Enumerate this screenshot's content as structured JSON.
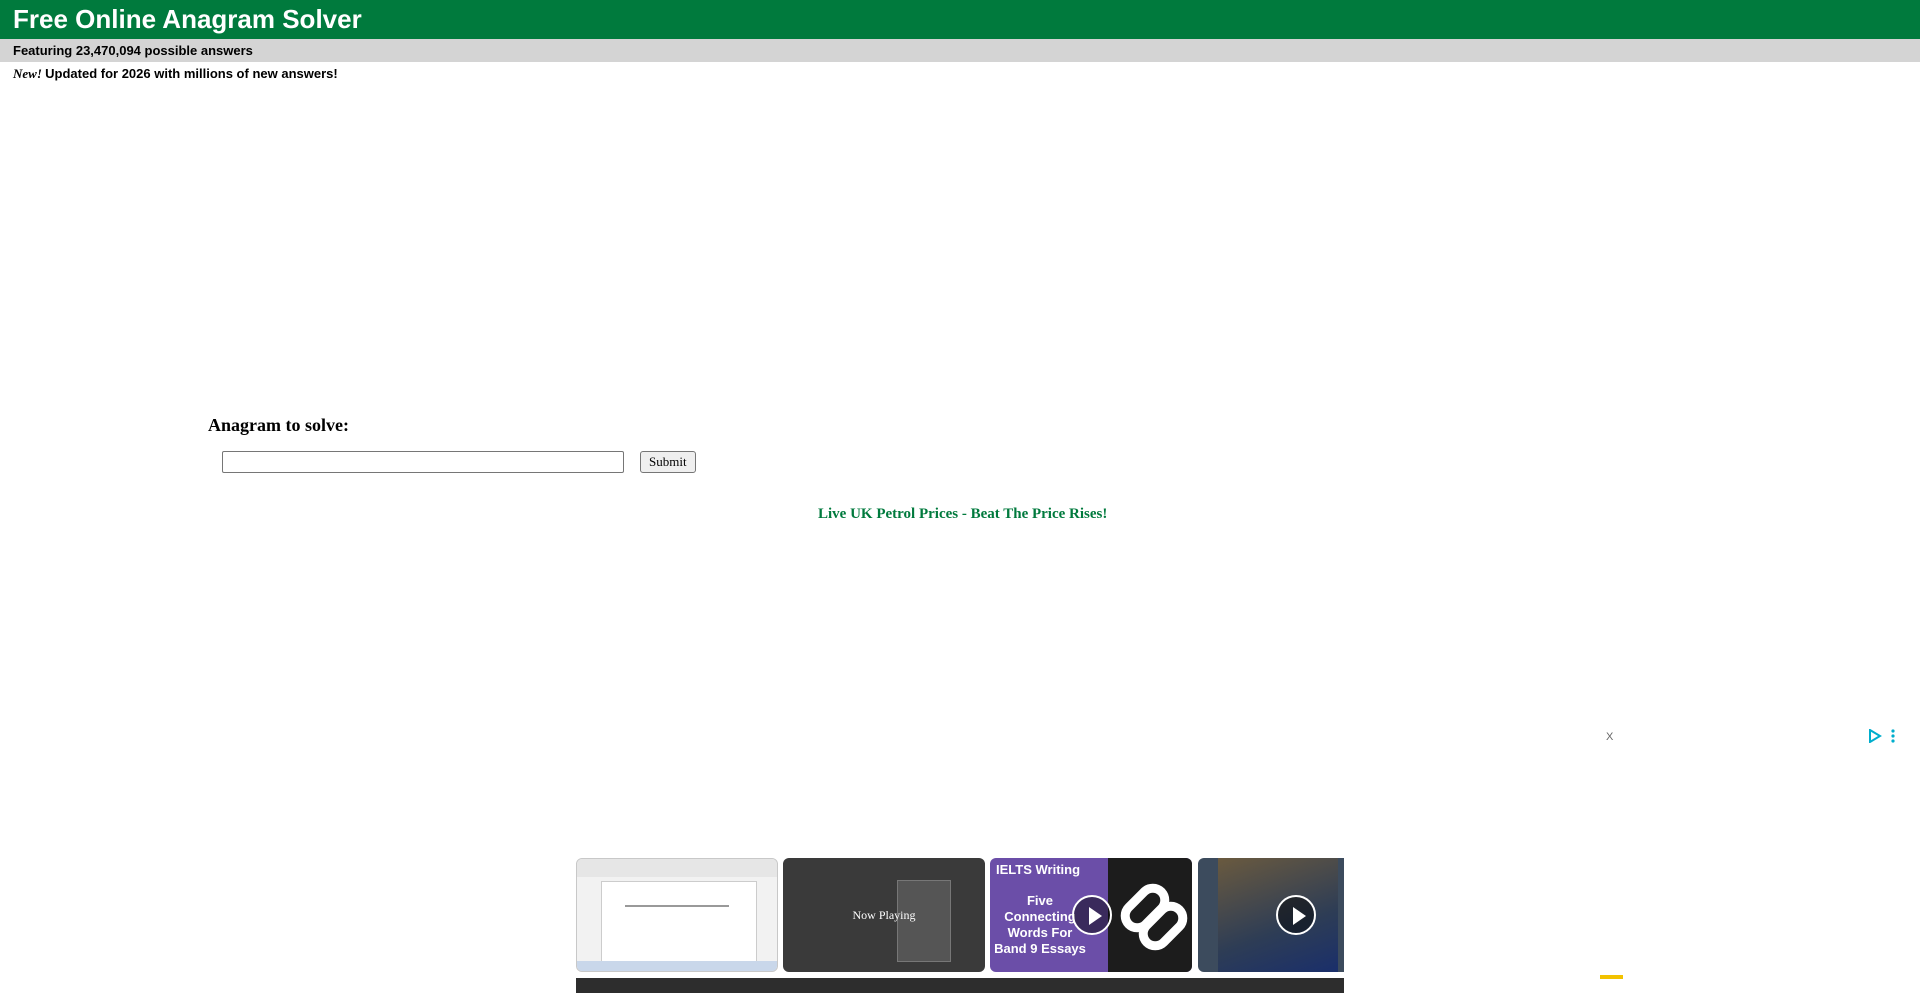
{
  "header": {
    "title": "Free Online Anagram Solver"
  },
  "subheader": {
    "text": "Featuring 23,470,094 possible answers"
  },
  "news": {
    "badge": "New!",
    "text": "Updated for 2026 with millions of new answers!"
  },
  "form": {
    "label": "Anagram to solve:",
    "input_value": "",
    "submit_label": "Submit"
  },
  "promo": {
    "text": "Live UK Petrol Prices - Beat The Price Rises!"
  },
  "ad": {
    "close_label": "X",
    "icons": [
      "adchoices-play-icon",
      "more-options-icon"
    ]
  },
  "video_strip": {
    "now_playing_label": "Now Playing",
    "card3_title": "IELTS Writing",
    "card3_subtitle": "Five Connecting Words For Band 9 Essays"
  },
  "colors": {
    "brand_green": "#007a3d",
    "subbar_gray": "#d4d4d4",
    "ad_icon_blue": "#00aecd"
  }
}
